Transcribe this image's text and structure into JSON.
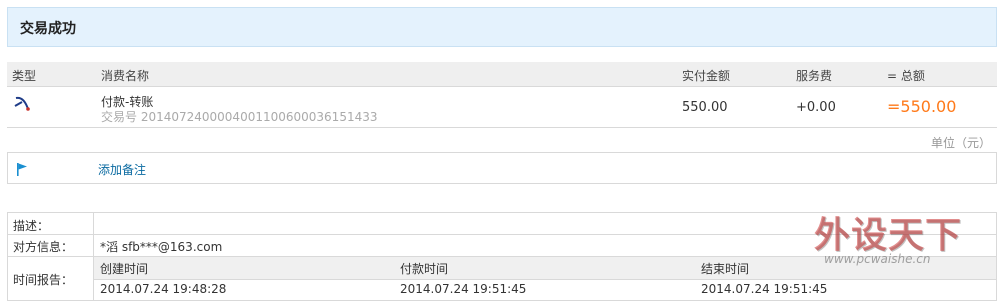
{
  "banner": {
    "title": "交易成功"
  },
  "table": {
    "headers": {
      "type": "类型",
      "name": "消费名称",
      "paid": "实付金额",
      "fee": "服务费",
      "total": "= 总额"
    },
    "row": {
      "icon": "transfer-icon",
      "name": "付款-转账",
      "trade_no": "交易号 2014072400004001100600036151433",
      "paid": "550.00",
      "fee": "+0.00",
      "total": "=550.00"
    }
  },
  "unit": "单位（元）",
  "remark": {
    "icon": "flag-icon",
    "label": "添加备注"
  },
  "info": {
    "desc_label": "描述：",
    "desc_value": "",
    "party_label": "对方信息：",
    "party_value": "*滔 sfb***@163.com",
    "time_label": "时间报告：",
    "time": {
      "created_label": "创建时间",
      "paid_label": "付款时间",
      "finished_label": "结束时间",
      "created": "2014.07.24 19:48:28",
      "paid": "2014.07.24 19:51:45",
      "finished": "2014.07.24 19:51:45"
    }
  },
  "watermark": {
    "cn": "外设天下",
    "url": "www.pcwaishe.cn"
  },
  "colors": {
    "accent": "#ff7a1a",
    "link": "#0a6aa1",
    "banner": "#e4f2fd"
  }
}
